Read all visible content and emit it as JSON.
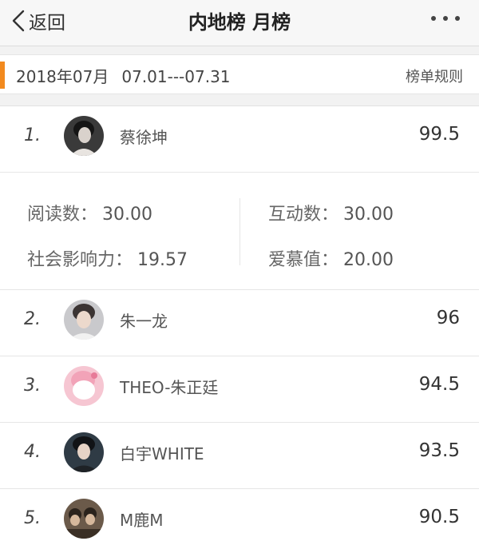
{
  "nav": {
    "back_label": "返回",
    "title": "内地榜 月榜",
    "more_icon": "more-dots-icon"
  },
  "period": {
    "month": "2018年07月",
    "range": "07.01---07.31",
    "rules_label": "榜单规则",
    "accent_color": "#f28a1f"
  },
  "ranking": [
    {
      "rank": "1.",
      "name": "蔡徐坤",
      "score": "99.5"
    },
    {
      "rank": "2.",
      "name": "朱一龙",
      "score": "96"
    },
    {
      "rank": "3.",
      "name": "THEO-朱正廷",
      "score": "94.5"
    },
    {
      "rank": "4.",
      "name": "白宇WHITE",
      "score": "93.5"
    },
    {
      "rank": "5.",
      "name": "M鹿M",
      "score": "90.5"
    }
  ],
  "detail": {
    "reads_label": "阅读数：",
    "reads_value": "30.00",
    "interact_label": "互动数：",
    "interact_value": "30.00",
    "influence_label": "社会影响力：",
    "influence_value": "19.57",
    "love_label": "爱慕值：",
    "love_value": "20.00"
  }
}
